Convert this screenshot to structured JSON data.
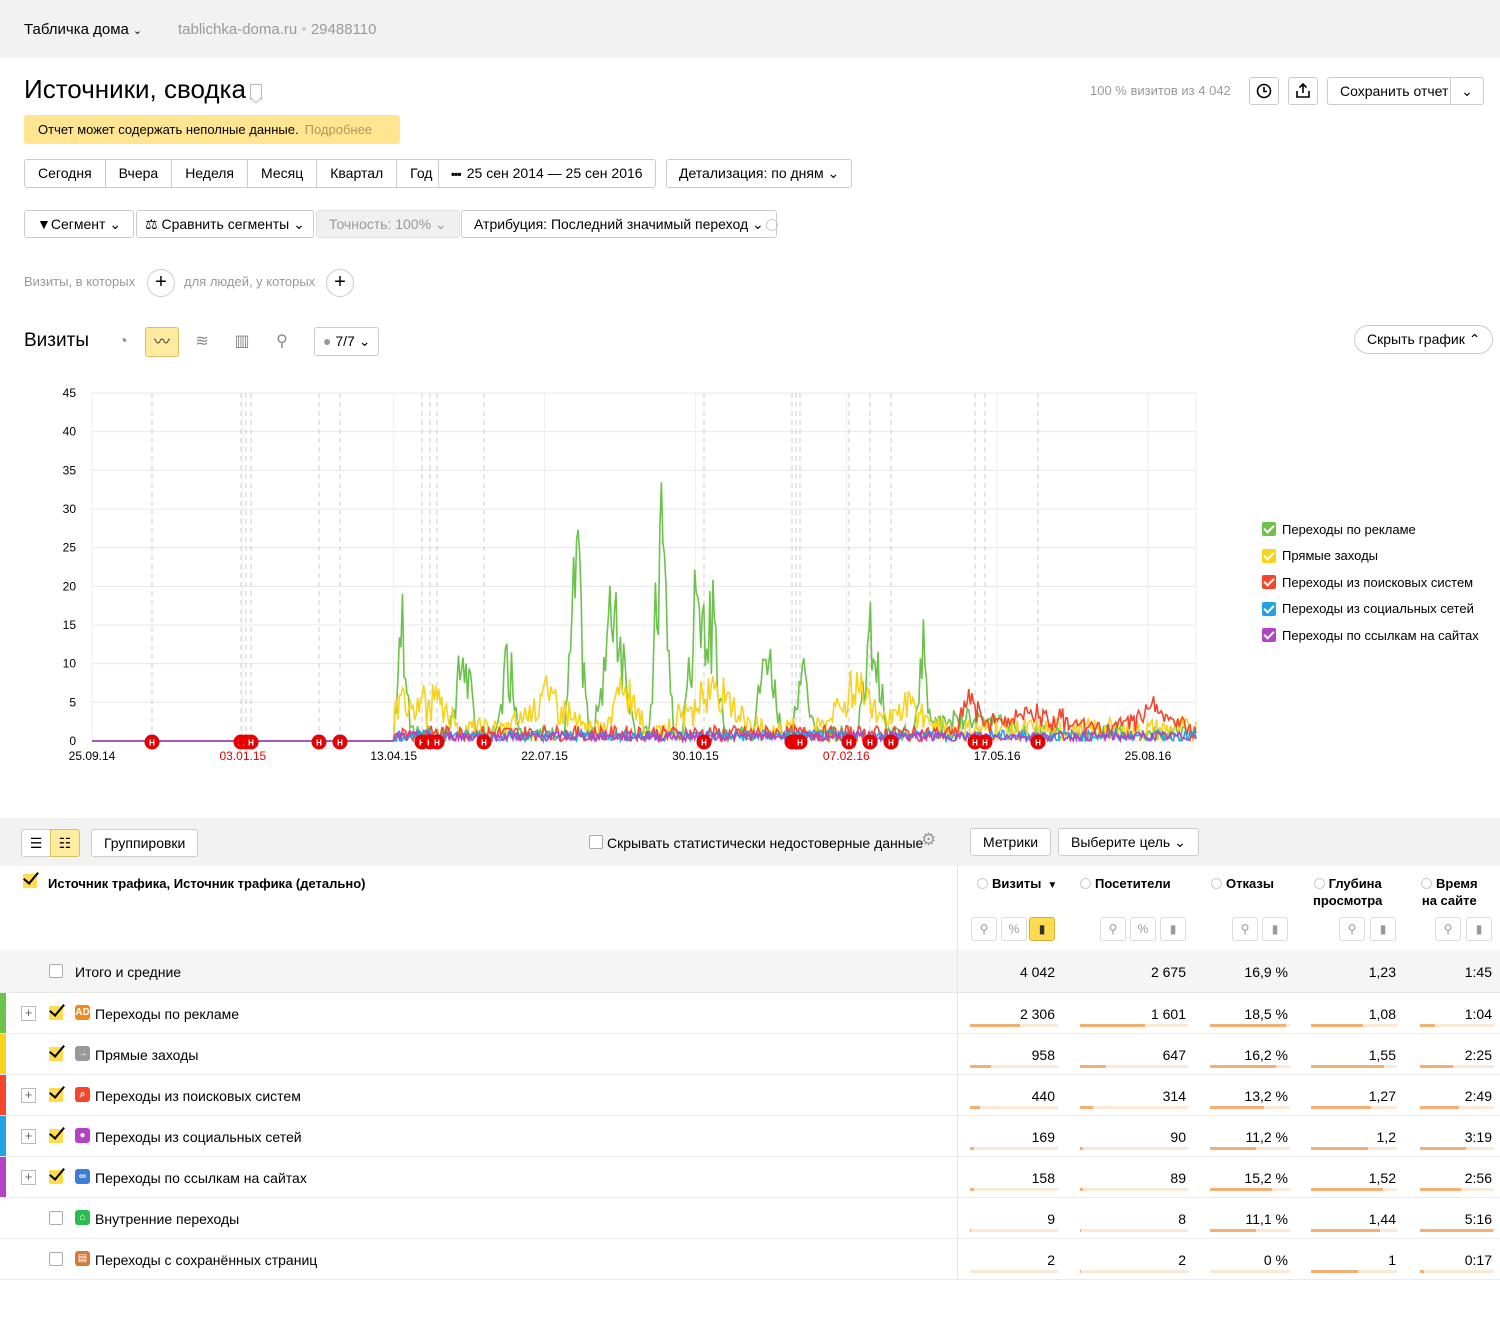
{
  "header": {
    "site_name": "Табличка дома",
    "site_url": "tablichka-doma.ru",
    "counter_id": "29488110"
  },
  "page": {
    "title": "Источники, сводка",
    "visits_share": "100 % визитов из 4 042",
    "save_report": "Сохранить отчет"
  },
  "warning": {
    "text": "Отчет может содержать неполные данные.",
    "more": "Подробнее"
  },
  "periods": [
    "Сегодня",
    "Вчера",
    "Неделя",
    "Месяц",
    "Квартал",
    "Год"
  ],
  "date_range": "25 сен 2014 — 25 сен 2016",
  "detail": "Детализация: по дням",
  "filters": {
    "segment": "Сегмент",
    "compare": "Сравнить сегменты",
    "accuracy": "Точность: 100%",
    "attribution": "Атрибуция: Последний значимый переход"
  },
  "segment_builder": {
    "visits_label": "Визиты, в которых",
    "people_label": "для людей, у которых"
  },
  "chart_section": {
    "title": "Визиты",
    "series_count": "7/7",
    "hide_chart": "Скрыть график"
  },
  "chart_data": {
    "type": "line",
    "ylim": [
      0,
      45
    ],
    "yticks": [
      0,
      5,
      10,
      15,
      20,
      25,
      30,
      35,
      40,
      45
    ],
    "xticks": [
      "25.09.14",
      "03.01.15",
      "13.04.15",
      "22.07.15",
      "30.10.15",
      "07.02.16",
      "17.05.16",
      "25.08.16"
    ],
    "red_xticks": [
      "03.01.15",
      "07.02.16"
    ],
    "note_marker": "Н",
    "series": [
      {
        "name": "Переходы по рекламе",
        "color": "#6cc24a"
      },
      {
        "name": "Прямые заходы",
        "color": "#f9d21e"
      },
      {
        "name": "Переходы из поисковых систем",
        "color": "#f5462d"
      },
      {
        "name": "Переходы из социальных сетей",
        "color": "#22a3e8"
      },
      {
        "name": "Переходы по ссылкам на сайтах",
        "color": "#b342c4"
      }
    ]
  },
  "table_toolbar": {
    "groupings": "Группировки",
    "hide_unreliable": "Скрывать статистически недостоверные данные",
    "metrics": "Метрики",
    "goal": "Выберите цель"
  },
  "table": {
    "dimension_header": "Источник трафика, Источник трафика (детально)",
    "columns": [
      "Визиты",
      "Посетители",
      "Отказы",
      "Глубина просмотра",
      "Время на сайте"
    ],
    "column_lines": [
      [
        "Визиты"
      ],
      [
        "Посетители"
      ],
      [
        "Отказы"
      ],
      [
        "Глубина",
        "просмотра"
      ],
      [
        "Время",
        "на сайте"
      ]
    ],
    "sort_marker": "▼",
    "total": {
      "label": "Итого и средние",
      "values": [
        "4 042",
        "2 675",
        "16,9 %",
        "1,23",
        "1:45"
      ]
    },
    "rows": [
      {
        "label": "Переходы по рекламе",
        "values": [
          "2 306",
          "1 601",
          "18,5 %",
          "1,08",
          "1:04"
        ],
        "color": "#6cc24a",
        "icon_color": "#f08a1e",
        "icon": "AD",
        "checked": true,
        "expandable": true,
        "bars": [
          0.57,
          0.6,
          0.95,
          0.6,
          0.2
        ]
      },
      {
        "label": "Прямые заходы",
        "values": [
          "958",
          "647",
          "16,2 %",
          "1,55",
          "2:25"
        ],
        "color": "#f9d21e",
        "icon_color": "#999999",
        "icon": "→",
        "checked": true,
        "expandable": false,
        "bars": [
          0.24,
          0.24,
          0.83,
          0.85,
          0.45
        ]
      },
      {
        "label": "Переходы из поисковых систем",
        "values": [
          "440",
          "314",
          "13,2 %",
          "1,27",
          "2:49"
        ],
        "color": "#f5462d",
        "icon_color": "#f5462d",
        "icon": "⌕",
        "checked": true,
        "expandable": true,
        "bars": [
          0.11,
          0.12,
          0.68,
          0.7,
          0.53
        ]
      },
      {
        "label": "Переходы из социальных сетей",
        "values": [
          "169",
          "90",
          "11,2 %",
          "1,2",
          "3:19"
        ],
        "color": "#22a3e8",
        "icon_color": "#b342c4",
        "icon": "●",
        "checked": true,
        "expandable": true,
        "bars": [
          0.04,
          0.03,
          0.57,
          0.66,
          0.62
        ]
      },
      {
        "label": "Переходы по ссылкам на сайтах",
        "values": [
          "158",
          "89",
          "15,2 %",
          "1,52",
          "2:56"
        ],
        "color": "#b342c4",
        "icon_color": "#3b7dd8",
        "icon": "∞",
        "checked": true,
        "expandable": true,
        "bars": [
          0.04,
          0.03,
          0.78,
          0.84,
          0.55
        ]
      },
      {
        "label": "Внутренние переходы",
        "values": [
          "9",
          "8",
          "11,1 %",
          "1,44",
          "5:16"
        ],
        "color": "",
        "icon_color": "#2bbb4e",
        "icon": "⌂",
        "checked": false,
        "expandable": false,
        "bars": [
          0.01,
          0.01,
          0.57,
          0.8,
          0.98
        ]
      },
      {
        "label": "Переходы с сохранённых страниц",
        "values": [
          "2",
          "2",
          "0 %",
          "1",
          "0:17"
        ],
        "color": "",
        "icon_color": "#d47a3a",
        "icon": "▤",
        "checked": false,
        "expandable": false,
        "bars": [
          0.005,
          0.005,
          0,
          0.55,
          0.05
        ]
      }
    ]
  }
}
